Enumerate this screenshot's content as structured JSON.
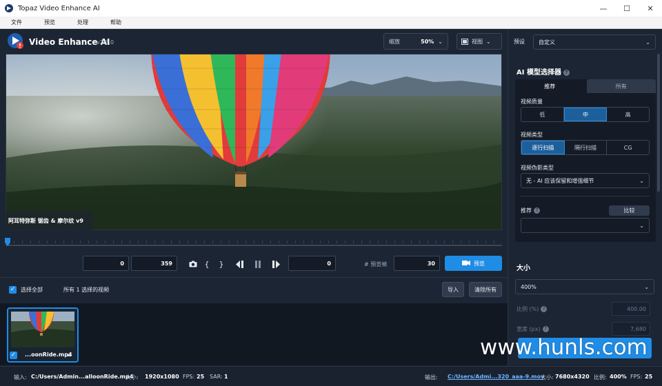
{
  "window": {
    "title": "Topaz Video Enhance AI",
    "controls": [
      "—",
      "☐",
      "✕"
    ]
  },
  "menu": [
    "文件",
    "预览",
    "处理",
    "帮助"
  ],
  "header": {
    "app_name": "Video Enhance AI",
    "version": "v2.3.0",
    "zoom_label": "缩放",
    "zoom_value": "50%",
    "view_label": "视图"
  },
  "preview": {
    "model_label": "阿耳特弥斯 锯齿 & 摩尔纹 v9"
  },
  "controls": {
    "start_frame": "0",
    "end_frame": "359",
    "current_frame": "0",
    "preview_frames_label": "# 预览帧",
    "preview_frames": "30",
    "preview_button": "预览"
  },
  "selection": {
    "select_all": "选择全部",
    "selected_count": "所有 1 选择的视频",
    "import": "导入",
    "clear_all": "清除所有"
  },
  "thumbnail": {
    "name": "...oonRide.mp4"
  },
  "status": {
    "input_label": "输入:",
    "input_path": "C:/Users/Admin...alloonRide.mp4",
    "size_label": "大小:",
    "size": "1920x1080",
    "fps_label": "FPS:",
    "fps": "25",
    "sar_label": "SAR:",
    "sar": "1",
    "output_label": "输出:",
    "output_path": "C:/Users/Admi...320_aaa-9.mov",
    "out_size_label": "大小:",
    "out_size": "7680x4320",
    "ratio_label": "比例:",
    "ratio": "400%",
    "out_fps_label": "FPS:",
    "out_fps": "25"
  },
  "panel": {
    "preset_label": "预设",
    "preset_value": "自定义",
    "ai_title": "AI 模型选择器",
    "tabs": [
      "推荐",
      "所有"
    ],
    "quality_label": "视频质量",
    "quality_options": [
      "低",
      "中",
      "高"
    ],
    "type_label": "视频类型",
    "type_options": [
      "逐行扫描",
      "隔行扫描",
      "CG"
    ],
    "artifact_label": "视频伪影类型",
    "artifact_value": "无 - AI 应该保留和增强细节",
    "recommend_label": "推荐",
    "compare_label": "比较",
    "size_title": "大小",
    "size_value": "400%",
    "scale_label": "比例 (%)",
    "scale_value": "400.00",
    "width_label": "宽度 (px)",
    "width_value": "7,680"
  },
  "watermark": "www.hunls.com",
  "colors": {
    "accent": "#1f8ce6",
    "background": "#1c2533",
    "panel": "#141b26"
  }
}
